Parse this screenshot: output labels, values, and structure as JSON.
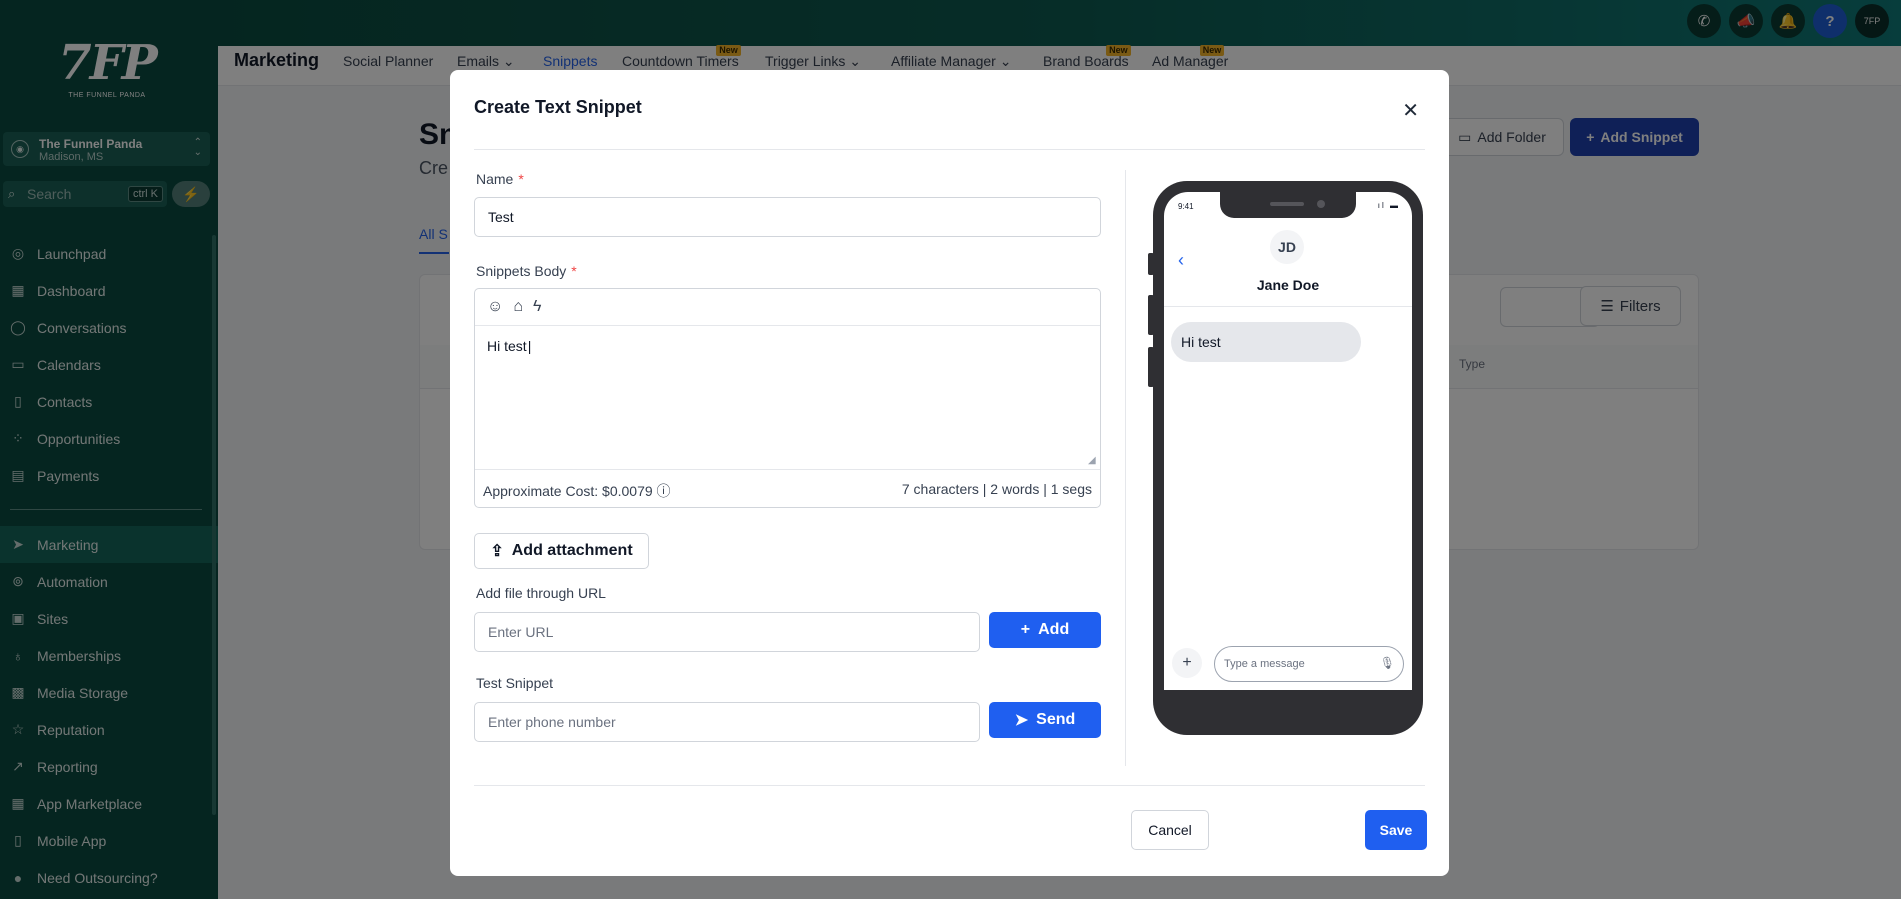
{
  "app": {
    "logo_mark": "7FP",
    "logo_text": "THE FUNNEL PANDA",
    "location_name": "The Funnel Panda",
    "location_city": "Madison, MS",
    "search_placeholder": "Search",
    "search_shortcut": "ctrl K"
  },
  "sidebar": {
    "items": [
      {
        "label": "Launchpad",
        "icon": "launchpad-icon",
        "glyph": "◎"
      },
      {
        "label": "Dashboard",
        "icon": "dashboard-icon",
        "glyph": "▦"
      },
      {
        "label": "Conversations",
        "icon": "chat-icon",
        "glyph": "◯"
      },
      {
        "label": "Calendars",
        "icon": "calendar-icon",
        "glyph": "▭"
      },
      {
        "label": "Contacts",
        "icon": "contacts-icon",
        "glyph": "▯"
      },
      {
        "label": "Opportunities",
        "icon": "opportunities-icon",
        "glyph": "⁘"
      },
      {
        "label": "Payments",
        "icon": "payments-icon",
        "glyph": "▤"
      },
      {
        "label": "Marketing",
        "icon": "send-icon",
        "glyph": "➤"
      },
      {
        "label": "Automation",
        "icon": "automation-icon",
        "glyph": "⊚"
      },
      {
        "label": "Sites",
        "icon": "sites-icon",
        "glyph": "▣"
      },
      {
        "label": "Memberships",
        "icon": "memberships-icon",
        "glyph": "♁"
      },
      {
        "label": "Media Storage",
        "icon": "media-icon",
        "glyph": "▩"
      },
      {
        "label": "Reputation",
        "icon": "star-icon",
        "glyph": "☆"
      },
      {
        "label": "Reporting",
        "icon": "reporting-icon",
        "glyph": "↗"
      },
      {
        "label": "App Marketplace",
        "icon": "marketplace-icon",
        "glyph": "▦"
      },
      {
        "label": "Mobile App",
        "icon": "mobile-icon",
        "glyph": "▯"
      },
      {
        "label": "Need Outsourcing?",
        "icon": "user-icon",
        "glyph": "●"
      }
    ],
    "active": "Marketing"
  },
  "subnav": {
    "title": "Marketing",
    "items": [
      "Social Planner",
      "Emails ⌄",
      "Snippets",
      "Countdown Timers",
      "Trigger Links ⌄",
      "Affiliate Manager ⌄",
      "Brand Boards",
      "Ad Manager"
    ],
    "new_badge": "New"
  },
  "background": {
    "title": "Sn",
    "subtitle": "Cre",
    "tab": "All S",
    "add_folder": "Add Folder",
    "add_snippet": "Add Snippet",
    "filters": "Filters",
    "type_col": "Type"
  },
  "modal": {
    "title": "Create Text Snippet",
    "name_label": "Name",
    "name_value": "Test",
    "body_label": "Snippets Body",
    "body_value": "Hi test",
    "cost": "Approximate Cost: $0.0079",
    "counts": "7 characters | 2 words | 1 segs",
    "add_attachment": "Add attachment",
    "file_url_label": "Add file through URL",
    "url_placeholder": "Enter URL",
    "add_button": "Add",
    "test_label": "Test Snippet",
    "phone_placeholder": "Enter phone number",
    "send_button": "Send",
    "cancel": "Cancel",
    "save": "Save",
    "required_mark": "*"
  },
  "preview": {
    "time": "9:41",
    "initials": "JD",
    "name": "Jane Doe",
    "message": "Hi test",
    "input_placeholder": "Type a message"
  },
  "colors": {
    "brand": "#0b4b40",
    "primary": "#1f5ff0"
  }
}
